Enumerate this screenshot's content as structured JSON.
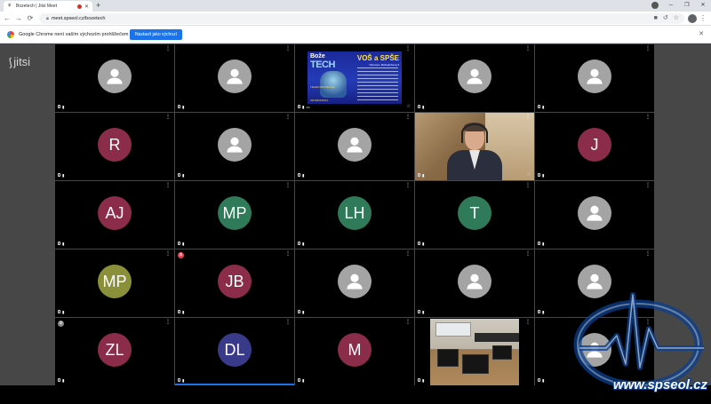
{
  "browser": {
    "tab_title": "Bozetech | Jitsi Meet",
    "new_tab": "+",
    "url": "meet.spseol.cz/bozetech",
    "infobar_message": "Google Chrome není vaším výchozím prohlížečem",
    "infobar_button": "Nastavit jako výchozí",
    "close_glyph": "✕",
    "back_glyph": "←",
    "forward_glyph": "→",
    "reload_glyph": "⟳",
    "menu_glyph": "⋮"
  },
  "app": {
    "logo_text": "jitsi"
  },
  "tiles": [
    {
      "kind": "default"
    },
    {
      "kind": "default"
    },
    {
      "kind": "screen",
      "poster": {
        "boze": "Bože",
        "tech": "TECH",
        "vos": "VOŠ a SPŠE",
        "sub": "Olomouc, Božetěchova 3",
        "tag": "TELEKOMUNIKACE",
        "foot": "INFORMATIKA"
      }
    },
    {
      "kind": "default"
    },
    {
      "kind": "default"
    },
    {
      "kind": "initials",
      "initials": "R",
      "color": "#8b2d4a"
    },
    {
      "kind": "default"
    },
    {
      "kind": "default"
    },
    {
      "kind": "camera"
    },
    {
      "kind": "initials",
      "initials": "J",
      "color": "#8b2d4a"
    },
    {
      "kind": "initials",
      "initials": "AJ",
      "color": "#8b2d4a"
    },
    {
      "kind": "initials",
      "initials": "MP",
      "color": "#2f7a58"
    },
    {
      "kind": "initials",
      "initials": "LH",
      "color": "#2f7a58"
    },
    {
      "kind": "initials",
      "initials": "T",
      "color": "#2f7a58"
    },
    {
      "kind": "default"
    },
    {
      "kind": "initials",
      "initials": "MP",
      "color": "#8a8f3a"
    },
    {
      "kind": "initials",
      "initials": "JB",
      "color": "#8b2d4a",
      "hand": "red"
    },
    {
      "kind": "default"
    },
    {
      "kind": "default"
    },
    {
      "kind": "default"
    },
    {
      "kind": "initials",
      "initials": "ZL",
      "color": "#8b2d4a",
      "hand": "gray"
    },
    {
      "kind": "initials",
      "initials": "DL",
      "color": "#3a3a8b",
      "active": true
    },
    {
      "kind": "initials",
      "initials": "M",
      "color": "#8b2d4a"
    },
    {
      "kind": "room"
    },
    {
      "kind": "default"
    }
  ],
  "watermark": {
    "text": "www.spseol.cz"
  }
}
